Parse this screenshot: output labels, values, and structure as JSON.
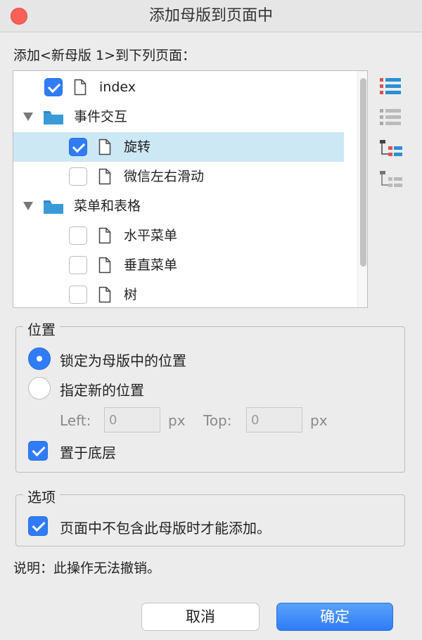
{
  "window": {
    "title": "添加母版到页面中"
  },
  "instruction": "添加<新母版 1>到下列页面：",
  "tree": [
    {
      "label": "index",
      "type": "page",
      "checked": true,
      "level": 1
    },
    {
      "label": "事件交互",
      "type": "folder",
      "expanded": true,
      "level": 0
    },
    {
      "label": "旋转",
      "type": "page",
      "checked": true,
      "level": 2,
      "selected": true
    },
    {
      "label": "微信左右滑动",
      "type": "page",
      "checked": false,
      "level": 2
    },
    {
      "label": "菜单和表格",
      "type": "folder",
      "expanded": true,
      "level": 0
    },
    {
      "label": "水平菜单",
      "type": "page",
      "checked": false,
      "level": 2
    },
    {
      "label": "垂直菜单",
      "type": "page",
      "checked": false,
      "level": 2
    },
    {
      "label": "树",
      "type": "page",
      "checked": false,
      "level": 2
    }
  ],
  "side_tools": [
    "check-all-icon",
    "uncheck-all-icon",
    "check-children-icon",
    "uncheck-children-icon"
  ],
  "position": {
    "group_title": "位置",
    "option_lock": "锁定为母版中的位置",
    "option_custom": "指定新的位置",
    "selected": "lock",
    "left_label": "Left:",
    "left_value": "0",
    "top_label": "Top:",
    "top_value": "0",
    "unit": "px",
    "bottom_layer_label": "置于底层",
    "bottom_layer_checked": true
  },
  "options": {
    "group_title": "选项",
    "only_if_missing_label": "页面中不包含此母版时才能添加。",
    "only_if_missing_checked": true
  },
  "note": "说明：此操作无法撤销。",
  "buttons": {
    "cancel": "取消",
    "ok": "确定"
  },
  "colors": {
    "accent": "#2f7cf6",
    "selection": "#cde8f5",
    "close": "#fc5f57",
    "folder": "#3a9ad9"
  }
}
